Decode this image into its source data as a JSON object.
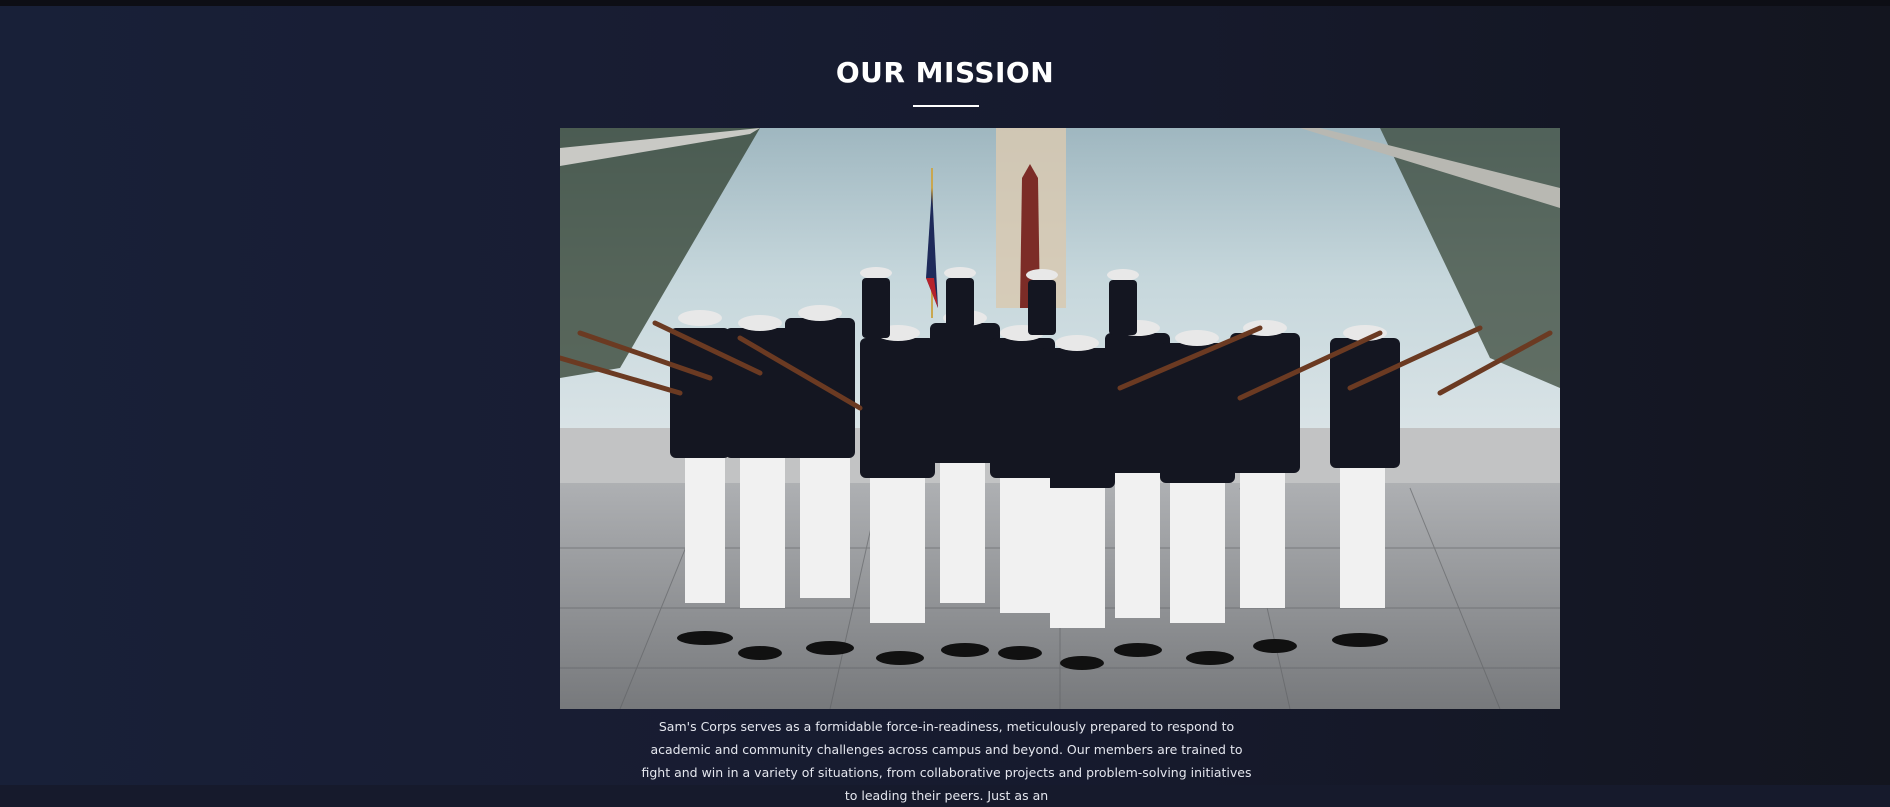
{
  "section": {
    "title": "OUR MISSION",
    "photo_alt": "Marine drill team performing a rifle salute in front of the Lincoln Memorial Reflecting Pool and Washington Monument",
    "paragraph": "Sam's Corps serves as a formidable force-in-readiness, meticulously prepared to respond to academic and community challenges across campus and beyond. Our members are trained to fight and win in a variety of situations, from collaborative projects and problem-solving initiatives to leading their peers. Just as an"
  },
  "colors": {
    "background": "#161a2c",
    "title": "#ffffff",
    "text": "#e4e6ee"
  }
}
